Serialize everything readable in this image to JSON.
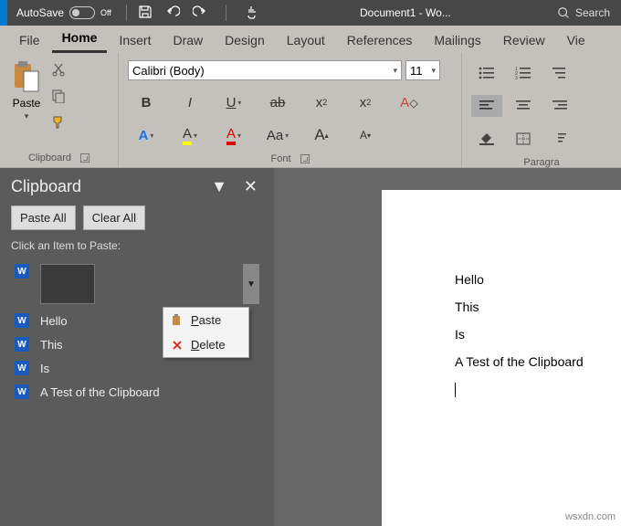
{
  "titlebar": {
    "autosave_label": "AutoSave",
    "autosave_state": "Off",
    "doc_title": "Document1 - Wo...",
    "search_label": "Search"
  },
  "tabs": [
    "File",
    "Home",
    "Insert",
    "Draw",
    "Design",
    "Layout",
    "References",
    "Mailings",
    "Review",
    "Vie"
  ],
  "active_tab": "Home",
  "ribbon": {
    "clipboard": {
      "label": "Clipboard",
      "paste": "Paste"
    },
    "font": {
      "label": "Font",
      "name": "Calibri (Body)",
      "size": "11",
      "bold": "B",
      "italic": "I",
      "underline": "U",
      "strike": "ab",
      "sub": "x",
      "sup": "x",
      "clear": "A",
      "effects": "A",
      "hl": "A",
      "color": "A",
      "case": "Aa",
      "grow": "A",
      "shrink": "A"
    },
    "para": {
      "label": "Paragra"
    }
  },
  "clip_pane": {
    "title": "Clipboard",
    "paste_all": "Paste All",
    "clear_all": "Clear All",
    "instruction": "Click an Item to Paste:",
    "items": [
      "Hello",
      "This",
      "Is",
      "A Test of the Clipboard"
    ],
    "ctx_paste": "Paste",
    "ctx_delete": "Delete"
  },
  "document": {
    "lines": [
      "Hello",
      "This",
      "Is",
      "A Test of the Clipboard"
    ]
  },
  "watermark": "wsxdn.com"
}
